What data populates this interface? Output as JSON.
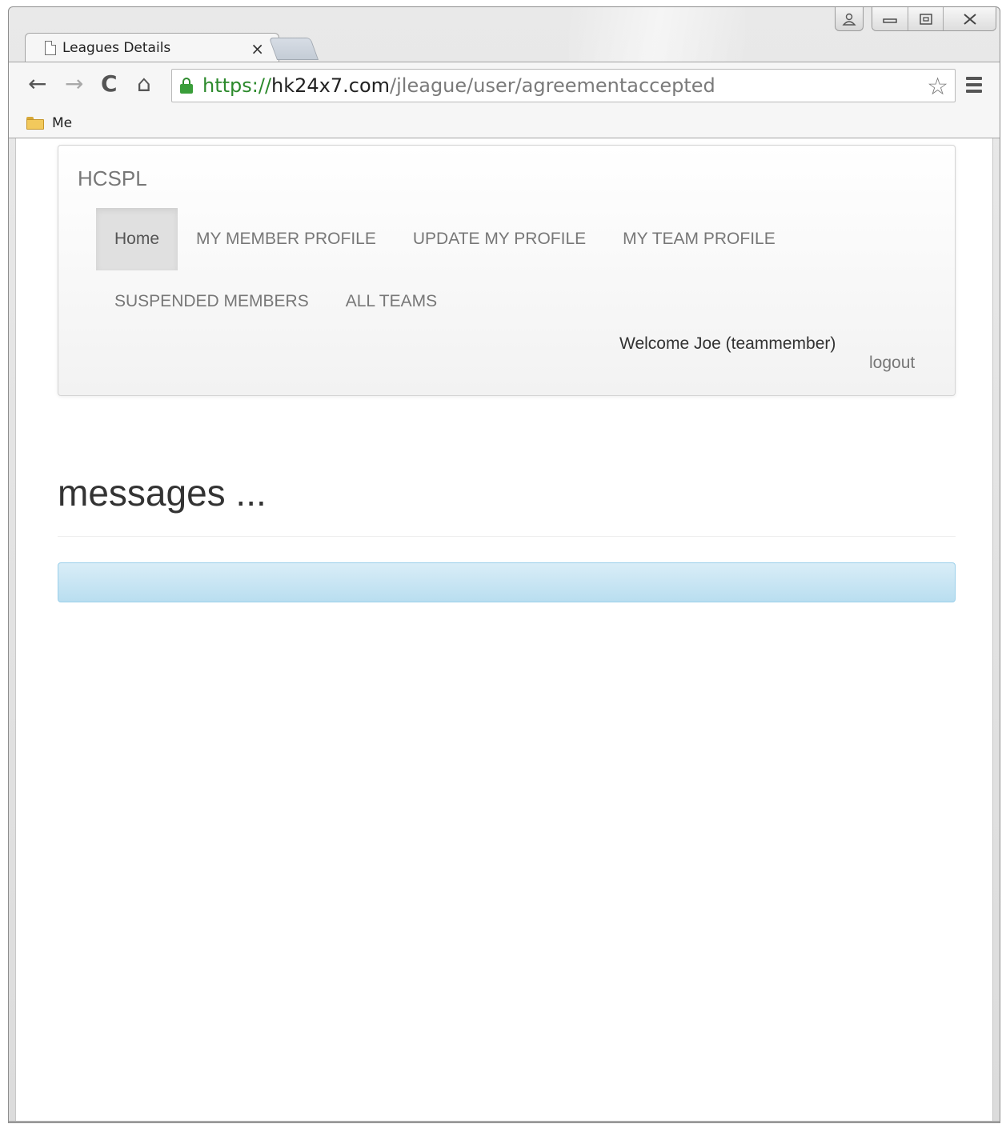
{
  "browser": {
    "tab_title": "Leagues Details",
    "tab_close": "×",
    "url_scheme": "https://",
    "url_host": "hk24x7.com",
    "url_path": "/jleague/user/agreementaccepted",
    "bookmark_label": "Me",
    "icons": {
      "back": "←",
      "forward": "→",
      "reload": "C",
      "home": "⌂",
      "star": "☆"
    }
  },
  "app": {
    "brand": "HCSPL",
    "nav_items": [
      "Home",
      "MY MEMBER PROFILE",
      "UPDATE MY PROFILE",
      "MY TEAM PROFILE",
      "SUSPENDED MEMBERS",
      "ALL TEAMS"
    ],
    "active_nav": "Home",
    "welcome": "Welcome Joe (teammember)",
    "logout": "logout"
  },
  "content": {
    "heading": "messages ...",
    "alert_text": ""
  },
  "colors": {
    "alert_bg": "#d9edf7",
    "alert_border": "#9acfea",
    "secure_green": "#2c8a2c"
  }
}
